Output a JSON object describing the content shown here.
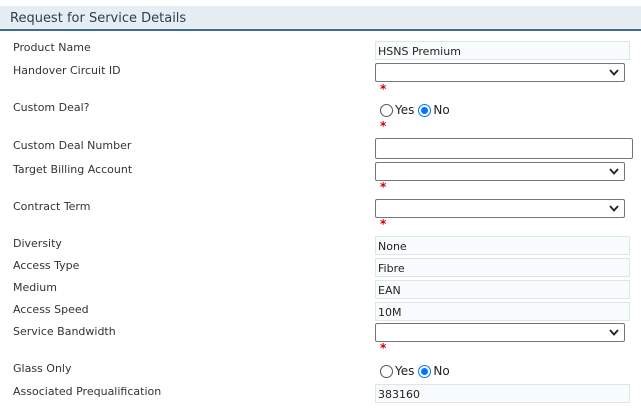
{
  "panel": {
    "title": "Request for Service Details"
  },
  "fields": {
    "product_name": {
      "label": "Product Name",
      "value": "HSNS Premium"
    },
    "handover_circuit_id": {
      "label": "Handover Circuit ID",
      "value": "",
      "required": "*"
    },
    "custom_deal": {
      "label": "Custom Deal?",
      "yes": "Yes",
      "no": "No",
      "selected": "No",
      "required": "*"
    },
    "custom_deal_number": {
      "label": "Custom Deal Number",
      "value": ""
    },
    "target_billing_account": {
      "label": "Target Billing Account",
      "value": "",
      "required": "*"
    },
    "contract_term": {
      "label": "Contract Term",
      "value": "",
      "required": "*"
    },
    "diversity": {
      "label": "Diversity",
      "value": "None"
    },
    "access_type": {
      "label": "Access Type",
      "value": "Fibre"
    },
    "medium": {
      "label": "Medium",
      "value": "EAN"
    },
    "access_speed": {
      "label": "Access Speed",
      "value": "10M"
    },
    "service_bandwidth": {
      "label": "Service Bandwidth",
      "value": "",
      "required": "*"
    },
    "glass_only": {
      "label": "Glass Only",
      "yes": "Yes",
      "no": "No",
      "selected": "No"
    },
    "associated_prequalification": {
      "label": "Associated Prequalification",
      "value": "383160"
    }
  },
  "icons": {
    "dropdown": "chevron-down-icon"
  },
  "colors": {
    "header_bg": "#e6eef3",
    "header_border": "#3d6f8c",
    "required": "#cc0000",
    "radio_selected": "#0075ff"
  }
}
